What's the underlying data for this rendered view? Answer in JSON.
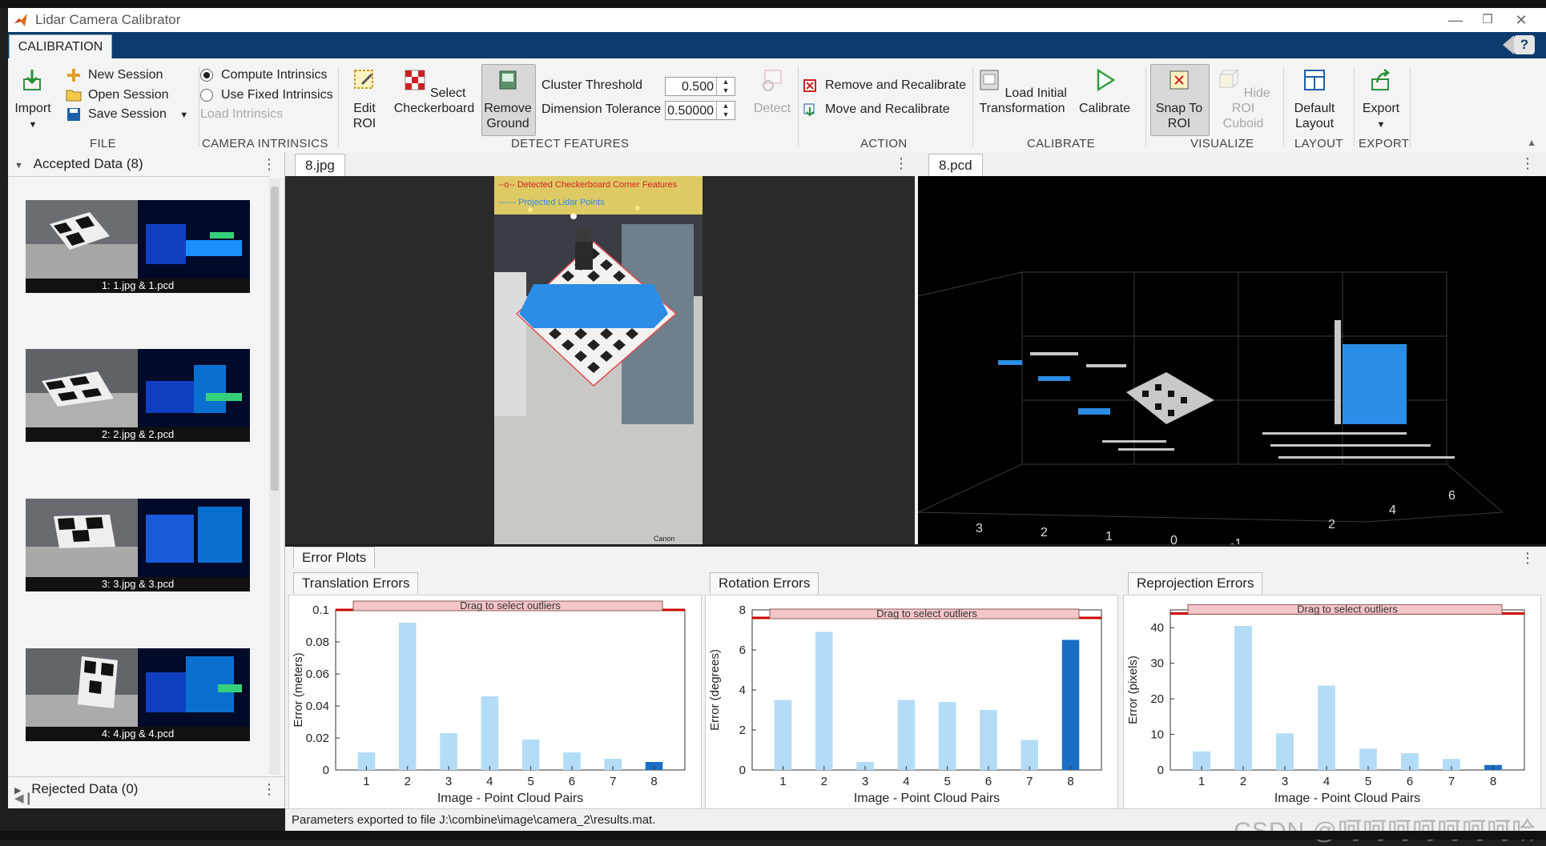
{
  "window": {
    "title": "Lidar Camera Calibrator"
  },
  "tabs": {
    "active": "CALIBRATION",
    "help": "?"
  },
  "ribbon": {
    "file": {
      "import": "Import",
      "new_session": "New Session",
      "open_session": "Open Session",
      "save_session": "Save Session",
      "group": "FILE"
    },
    "intrinsics": {
      "compute": "Compute Intrinsics",
      "fixed": "Use Fixed Intrinsics",
      "load": "Load Intrinsics",
      "group": "CAMERA INTRINSICS"
    },
    "detect": {
      "edit_roi_1": "Edit",
      "edit_roi_2": "ROI",
      "select_cb_1": "Select",
      "select_cb_2": "Checkerboard",
      "remove_ground_1": "Remove",
      "remove_ground_2": "Ground",
      "cluster_threshold": "Cluster Threshold",
      "cluster_value": "0.500",
      "dimension_tolerance": "Dimension Tolerance",
      "dimension_value": "0.50000",
      "detect": "Detect",
      "group": "DETECT FEATURES"
    },
    "action": {
      "remove_recal": "Remove and Recalibrate",
      "move_recal": "Move and Recalibrate",
      "group": "ACTION"
    },
    "calibrate": {
      "load_initial_1": "Load Initial",
      "load_initial_2": "Transformation",
      "calibrate": "Calibrate",
      "group": "CALIBRATE"
    },
    "visualize": {
      "snap_1": "Snap To",
      "snap_2": "ROI",
      "hide_1": "Hide ROI",
      "hide_2": "Cuboid",
      "group": "VISUALIZE"
    },
    "layout": {
      "default_1": "Default",
      "default_2": "Layout",
      "group": "LAYOUT"
    },
    "export": {
      "export": "Export",
      "group": "EXPORT"
    }
  },
  "left_panel": {
    "accepted": "Accepted Data (8)",
    "rejected": "Rejected Data (0)",
    "items": [
      {
        "label": "1: 1.jpg & 1.pcd"
      },
      {
        "label": "2: 2.jpg & 2.pcd"
      },
      {
        "label": "3: 3.jpg & 3.pcd"
      },
      {
        "label": "4: 4.jpg & 4.pcd"
      }
    ]
  },
  "image_view": {
    "tab": "8.jpg",
    "legend1": "--o-- Detected Checkerboard Corner Features",
    "legend2": "------ Projected Lidar Points",
    "watermark": "Canon"
  },
  "pcd_view": {
    "tab": "8.pcd",
    "x_ticks": [
      "3",
      "2",
      "1",
      "0",
      "-1"
    ],
    "y_ticks": [
      "2",
      "4",
      "6"
    ]
  },
  "error_plots": {
    "tab": "Error Plots",
    "banner": "Drag to select outliers",
    "colors": {
      "bar": "#b3dcf6",
      "selected": "#1a6fc4",
      "threshold": "#cc0000",
      "banner": "#f5c6c8"
    }
  },
  "chart_data": [
    {
      "type": "bar",
      "title": "Translation Errors",
      "xlabel": "Image - Point Cloud Pairs",
      "ylabel": "Error (meters)",
      "categories": [
        "1",
        "2",
        "3",
        "4",
        "5",
        "6",
        "7",
        "8"
      ],
      "values": [
        0.011,
        0.092,
        0.023,
        0.046,
        0.019,
        0.011,
        0.007,
        0.005
      ],
      "ylim": [
        0,
        0.1
      ],
      "yticks": [
        "0",
        "0.02",
        "0.04",
        "0.06",
        "0.08",
        "0.1"
      ],
      "threshold": 0.1,
      "selected_index": 7
    },
    {
      "type": "bar",
      "title": "Rotation Errors",
      "xlabel": "Image - Point Cloud Pairs",
      "ylabel": "Error (degrees)",
      "categories": [
        "1",
        "2",
        "3",
        "4",
        "5",
        "6",
        "7",
        "8"
      ],
      "values": [
        3.5,
        6.9,
        0.4,
        3.5,
        3.4,
        3.0,
        1.5,
        6.5
      ],
      "ylim": [
        0,
        8
      ],
      "yticks": [
        "0",
        "2",
        "4",
        "6",
        "8"
      ],
      "threshold": 7.6,
      "selected_index": 7
    },
    {
      "type": "bar",
      "title": "Reprojection Errors",
      "xlabel": "Image - Point Cloud Pairs",
      "ylabel": "Error (pixels)",
      "categories": [
        "1",
        "2",
        "3",
        "4",
        "5",
        "6",
        "7",
        "8"
      ],
      "values": [
        5.2,
        40.5,
        10.3,
        23.7,
        6.0,
        4.7,
        3.1,
        1.4
      ],
      "ylim": [
        0,
        45
      ],
      "yticks": [
        "0",
        "10",
        "20",
        "30",
        "40"
      ],
      "threshold": 44,
      "selected_index": 7
    }
  ],
  "status": {
    "message": "Parameters exported to file J:\\combine\\image\\camera_2\\results.mat.",
    "watermark": "CSDN @呵呵呵呵呵呵呵哈"
  }
}
